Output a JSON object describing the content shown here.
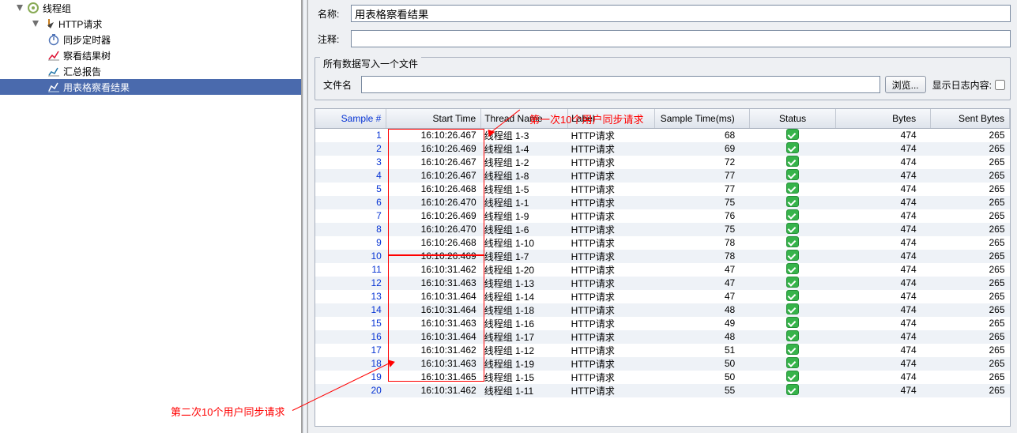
{
  "sidebar": {
    "items": [
      {
        "label": "线程组",
        "icon": "thread-group"
      },
      {
        "label": "HTTP请求",
        "icon": "http-request"
      },
      {
        "label": "同步定时器",
        "icon": "timer"
      },
      {
        "label": "察看结果树",
        "icon": "result-tree"
      },
      {
        "label": "汇总报告",
        "icon": "summary-report"
      },
      {
        "label": "用表格察看结果",
        "icon": "table-results"
      }
    ]
  },
  "form": {
    "name_label": "名称:",
    "name_value": "用表格察看结果",
    "comment_label": "注释:",
    "comment_value": "",
    "section_title": "所有数据写入一个文件",
    "file_label": "文件名",
    "file_value": "",
    "browse_label": "浏览...",
    "show_log_label": "显示日志内容:"
  },
  "annotations": {
    "first": "第一次10个用户同步请求",
    "second": "第二次10个用户同步请求"
  },
  "table": {
    "headers": [
      "Sample #",
      "Start Time",
      "Thread Name",
      "Label",
      "Sample Time(ms)",
      "Status",
      "Bytes",
      "Sent Bytes"
    ],
    "rows": [
      {
        "n": 1,
        "start": "16:10:26.467",
        "thread": "线程组 1-3",
        "label": "HTTP请求",
        "time": 68,
        "bytes": 474,
        "sent": 265
      },
      {
        "n": 2,
        "start": "16:10:26.469",
        "thread": "线程组 1-4",
        "label": "HTTP请求",
        "time": 69,
        "bytes": 474,
        "sent": 265
      },
      {
        "n": 3,
        "start": "16:10:26.467",
        "thread": "线程组 1-2",
        "label": "HTTP请求",
        "time": 72,
        "bytes": 474,
        "sent": 265
      },
      {
        "n": 4,
        "start": "16:10:26.467",
        "thread": "线程组 1-8",
        "label": "HTTP请求",
        "time": 77,
        "bytes": 474,
        "sent": 265
      },
      {
        "n": 5,
        "start": "16:10:26.468",
        "thread": "线程组 1-5",
        "label": "HTTP请求",
        "time": 77,
        "bytes": 474,
        "sent": 265
      },
      {
        "n": 6,
        "start": "16:10:26.470",
        "thread": "线程组 1-1",
        "label": "HTTP请求",
        "time": 75,
        "bytes": 474,
        "sent": 265
      },
      {
        "n": 7,
        "start": "16:10:26.469",
        "thread": "线程组 1-9",
        "label": "HTTP请求",
        "time": 76,
        "bytes": 474,
        "sent": 265
      },
      {
        "n": 8,
        "start": "16:10:26.470",
        "thread": "线程组 1-6",
        "label": "HTTP请求",
        "time": 75,
        "bytes": 474,
        "sent": 265
      },
      {
        "n": 9,
        "start": "16:10:26.468",
        "thread": "线程组 1-10",
        "label": "HTTP请求",
        "time": 78,
        "bytes": 474,
        "sent": 265
      },
      {
        "n": 10,
        "start": "16:10:26.469",
        "thread": "线程组 1-7",
        "label": "HTTP请求",
        "time": 78,
        "bytes": 474,
        "sent": 265
      },
      {
        "n": 11,
        "start": "16:10:31.462",
        "thread": "线程组 1-20",
        "label": "HTTP请求",
        "time": 47,
        "bytes": 474,
        "sent": 265
      },
      {
        "n": 12,
        "start": "16:10:31.463",
        "thread": "线程组 1-13",
        "label": "HTTP请求",
        "time": 47,
        "bytes": 474,
        "sent": 265
      },
      {
        "n": 13,
        "start": "16:10:31.464",
        "thread": "线程组 1-14",
        "label": "HTTP请求",
        "time": 47,
        "bytes": 474,
        "sent": 265
      },
      {
        "n": 14,
        "start": "16:10:31.464",
        "thread": "线程组 1-18",
        "label": "HTTP请求",
        "time": 48,
        "bytes": 474,
        "sent": 265
      },
      {
        "n": 15,
        "start": "16:10:31.463",
        "thread": "线程组 1-16",
        "label": "HTTP请求",
        "time": 49,
        "bytes": 474,
        "sent": 265
      },
      {
        "n": 16,
        "start": "16:10:31.464",
        "thread": "线程组 1-17",
        "label": "HTTP请求",
        "time": 48,
        "bytes": 474,
        "sent": 265
      },
      {
        "n": 17,
        "start": "16:10:31.462",
        "thread": "线程组 1-12",
        "label": "HTTP请求",
        "time": 51,
        "bytes": 474,
        "sent": 265
      },
      {
        "n": 18,
        "start": "16:10:31.463",
        "thread": "线程组 1-19",
        "label": "HTTP请求",
        "time": 50,
        "bytes": 474,
        "sent": 265
      },
      {
        "n": 19,
        "start": "16:10:31.465",
        "thread": "线程组 1-15",
        "label": "HTTP请求",
        "time": 50,
        "bytes": 474,
        "sent": 265
      },
      {
        "n": 20,
        "start": "16:10:31.462",
        "thread": "线程组 1-11",
        "label": "HTTP请求",
        "time": 55,
        "bytes": 474,
        "sent": 265
      }
    ]
  }
}
